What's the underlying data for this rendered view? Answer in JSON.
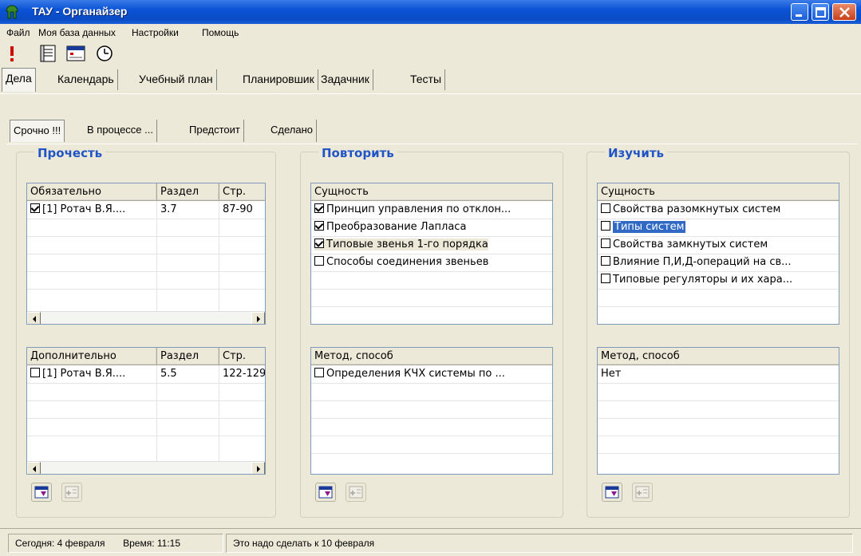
{
  "window": {
    "title": "ТАУ  -  Органайзер"
  },
  "menu": [
    "Файл",
    "Моя база данных",
    "Настройки",
    "Помощь"
  ],
  "toolbar_icons": [
    "exclamation-icon",
    "list-icon",
    "calendar-icon",
    "clock-icon"
  ],
  "main_tabs": [
    "Дела",
    "Календарь",
    "Учебный план",
    "Планировшик",
    "Задачник",
    "Тесты"
  ],
  "sub_tabs": [
    "Срочно !!!",
    "В процессе ...",
    "Предстоит",
    "Сделано"
  ],
  "groups": {
    "read": {
      "title": "Прочесть",
      "required": {
        "headers": [
          "Обязательно",
          "Раздел",
          "Стр."
        ],
        "rows": [
          {
            "checked": true,
            "name": "[1] Ротач В.Я....",
            "section": "3.7",
            "pages": "87-90"
          }
        ]
      },
      "additional": {
        "headers": [
          "Дополнительно",
          "Раздел",
          "Стр."
        ],
        "rows": [
          {
            "checked": false,
            "name": "[1] Ротач В.Я....",
            "section": "5.5",
            "pages": "122-129"
          }
        ]
      }
    },
    "repeat": {
      "title": "Повторить",
      "essence": {
        "header": "Сущность",
        "rows": [
          {
            "checked": true,
            "text": "Принцип управления по отклон..."
          },
          {
            "checked": true,
            "text": "Преобразование Лапласа"
          },
          {
            "checked": true,
            "text": "Типовые звенья 1-го порядка"
          },
          {
            "checked": false,
            "text": "Способы соединения звеньев"
          }
        ]
      },
      "method": {
        "header": "Метод, способ",
        "rows": [
          {
            "checked": false,
            "text": "Определения КЧХ системы по ..."
          }
        ]
      }
    },
    "study": {
      "title": "Изучить",
      "essence": {
        "header": "Сущность",
        "rows": [
          {
            "checked": false,
            "text": "Свойства разомкнутых систем"
          },
          {
            "checked": false,
            "text": "Типы систем"
          },
          {
            "checked": false,
            "text": "Свойства замкнутых систем"
          },
          {
            "checked": false,
            "text": "Влияние П,И,Д-операций на св..."
          },
          {
            "checked": false,
            "text": "Типовые регуляторы и их хара..."
          }
        ]
      },
      "method": {
        "header": "Метод, способ",
        "rows": [
          {
            "text": "Нет"
          }
        ]
      }
    }
  },
  "status": {
    "today": "Сегодня: 4 февраля",
    "time": "Время: 11:15",
    "deadline": "Это надо сделать к  10 февраля"
  },
  "colors": {
    "title_bar": "#0a53d6",
    "group_title": "#2155c6",
    "selection": "#316ac5"
  }
}
